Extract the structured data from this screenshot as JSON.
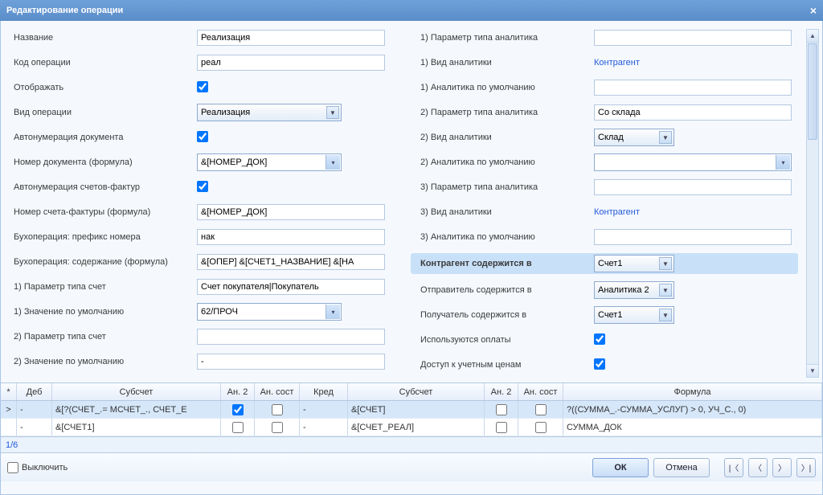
{
  "title": "Редактирование операции",
  "left": {
    "name_lbl": "Название",
    "name_val": "Реализация",
    "code_lbl": "Код операции",
    "code_val": "реал",
    "show_lbl": "Отображать",
    "type_lbl": "Вид операции",
    "type_val": "Реализация",
    "autonumdoc_lbl": "Автонумерация документа",
    "docnum_lbl": "Номер документа (формула)",
    "docnum_val": "&[НОМЕР_ДОК]",
    "autonumsf_lbl": "Автонумерация счетов-фактур",
    "sfnum_lbl": "Номер счета-фактуры (формула)",
    "sfnum_val": "&[НОМЕР_ДОК]",
    "buhpref_lbl": "Бухоперация: префикс номера",
    "buhpref_val": "нак",
    "buhcont_lbl": "Бухоперация: содержание (формула)",
    "buhcont_val": "&[ОПЕР] &[СЧЕТ1_НАЗВАНИЕ] &[НА",
    "p1acc_lbl": "1) Параметр типа счет",
    "p1acc_val": "Счет покупателя|Покупатель",
    "p1def_lbl": "1) Значение по умолчанию",
    "p1def_val": "62/ПРОЧ",
    "p2acc_lbl": "2) Параметр типа счет",
    "p2acc_val": "",
    "p2def_lbl": "2) Значение по умолчанию",
    "p2def_val": "-"
  },
  "right": {
    "p1an_lbl": "1) Параметр типа аналитика",
    "p1an_val": "",
    "v1an_lbl": "1) Вид аналитики",
    "v1an_val": "Контрагент",
    "d1an_lbl": "1) Аналитика по умолчанию",
    "d1an_val": "",
    "p2an_lbl": "2) Параметр типа аналитика",
    "p2an_val": "Со склада",
    "v2an_lbl": "2) Вид аналитики",
    "v2an_val": "Склад",
    "d2an_lbl": "2) Аналитика по умолчанию",
    "d2an_val": "",
    "p3an_lbl": "3) Параметр типа аналитика",
    "p3an_val": "",
    "v3an_lbl": "3) Вид аналитики",
    "v3an_val": "Контрагент",
    "d3an_lbl": "3) Аналитика по умолчанию",
    "d3an_val": "",
    "kontr_lbl": "Контрагент содержится в",
    "kontr_val": "Счет1",
    "send_lbl": "Отправитель содержится в",
    "send_val": "Аналитика 2",
    "recv_lbl": "Получатель содержится в",
    "recv_val": "Счет1",
    "pay_lbl": "Используются оплаты",
    "price_lbl": "Доступ к учетным ценам"
  },
  "grid": {
    "headers": [
      "*",
      "Деб",
      "Субсчет",
      "Ан. 2",
      "Ан. сост",
      "Кред",
      "Субсчет",
      "Ан. 2",
      "Ан. сост",
      "Формула"
    ],
    "rows": [
      {
        "sel": ">",
        "deb": "-",
        "sub1": "&[?(СЧЕТ_.= МСЧЕТ_., СЧЕТ_Е",
        "a2_1": true,
        "ac1": false,
        "kred": "-",
        "sub2": "&[СЧЕТ]",
        "a2_2": false,
        "ac2": false,
        "formula": "?((СУММА_.-СУММА_УСЛУГ) > 0, УЧ_С., 0)"
      },
      {
        "sel": "",
        "deb": "-",
        "sub1": "&[СЧЕТ1]",
        "a2_1": false,
        "ac1": false,
        "kred": "-",
        "sub2": "&[СЧЕТ_РЕАЛ]",
        "a2_2": false,
        "ac2": false,
        "formula": "СУММА_ДОК"
      }
    ],
    "page": "1/6"
  },
  "footer": {
    "disable_lbl": "Выключить",
    "ok": "ОК",
    "cancel": "Отмена"
  }
}
